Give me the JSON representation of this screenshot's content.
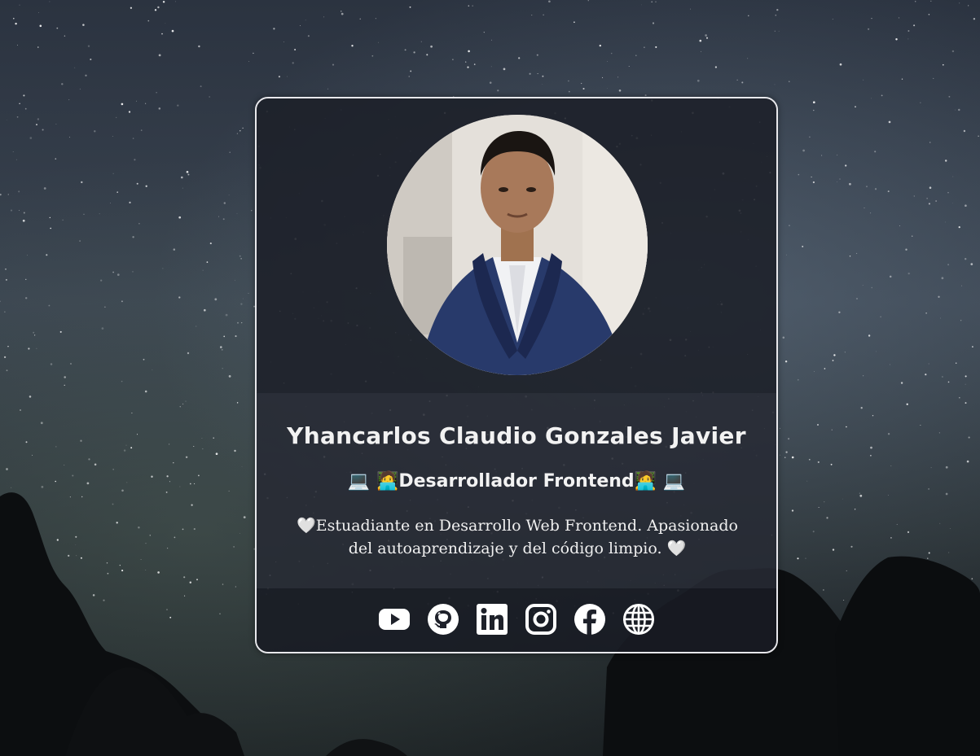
{
  "profile": {
    "name": "Yhancarlos Claudio Gonzales Javier",
    "role": "💻 🧑‍💻Desarrollador Frontend🧑‍💻 💻",
    "bio": "🤍Estuadiante en Desarrollo Web Frontend. Apasionado del autoaprendizaje y del código limpio. 🤍"
  },
  "socials": [
    {
      "icon": "youtube-icon"
    },
    {
      "icon": "github-icon"
    },
    {
      "icon": "linkedin-icon"
    },
    {
      "icon": "instagram-icon"
    },
    {
      "icon": "facebook-icon"
    },
    {
      "icon": "globe-icon"
    }
  ],
  "colors": {
    "card_border": "#e8e8ec",
    "text": "#f2f2f2",
    "icon": "#ffffff"
  }
}
